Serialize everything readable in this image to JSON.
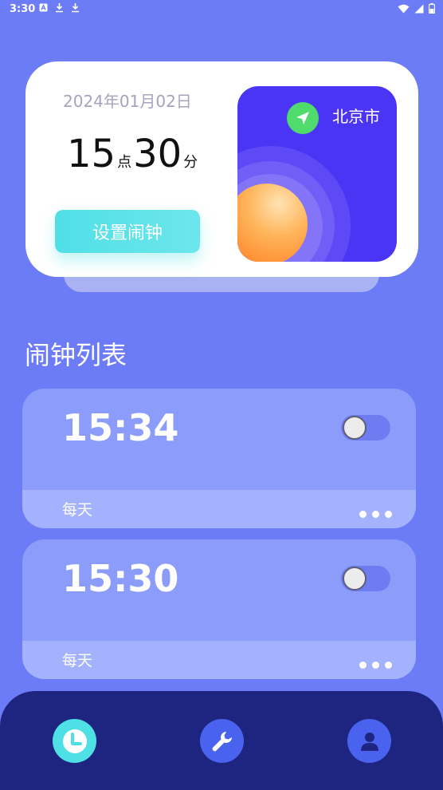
{
  "status_bar": {
    "time": "3:30",
    "icons_left": [
      "notification-a-icon",
      "download-icon",
      "download-icon"
    ],
    "icons_right": [
      "wifi-icon",
      "signal-icon",
      "battery-icon"
    ]
  },
  "clock_card": {
    "date": "2024年01月02日",
    "hour": "15",
    "hour_unit": "点",
    "minute": "30",
    "minute_unit": "分",
    "set_alarm_label": "设置闹钟"
  },
  "weather": {
    "city": "北京市",
    "location_icon": "location-arrow-icon",
    "colors": {
      "background": "#4b35f5",
      "pin": "#4fdc6c",
      "sun": "#ff9a3a"
    }
  },
  "alarm_list": {
    "title": "闹钟列表",
    "items": [
      {
        "time": "15:34",
        "repeat": "每天",
        "enabled": false
      },
      {
        "time": "15:30",
        "repeat": "每天",
        "enabled": false
      }
    ]
  },
  "bottom_nav": {
    "items": [
      {
        "icon": "clock-icon",
        "active": true
      },
      {
        "icon": "wrench-icon",
        "active": false
      },
      {
        "icon": "user-icon",
        "active": false
      }
    ]
  },
  "colors": {
    "page_background": "#6b7cf6",
    "accent": "#4fe0e6",
    "nav_background": "#1e2580"
  }
}
